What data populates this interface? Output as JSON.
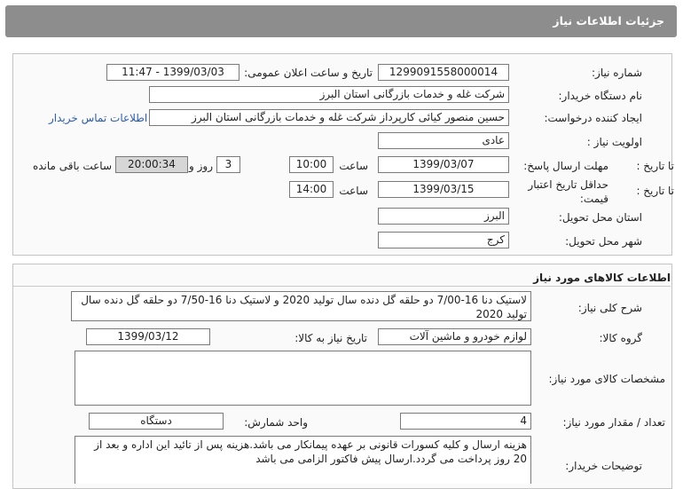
{
  "header": {
    "title": "جزئیات اطلاعات نیاز"
  },
  "info": {
    "need_number_label": "شماره نیاز:",
    "need_number": "1299091558000014",
    "announce_label": "تاریخ و ساعت اعلان عمومی:",
    "announce_value": "1399/03/03 - 11:47",
    "buyer_org_label": "نام دستگاه خریدار:",
    "buyer_org": "شرکت غله و خدمات بازرگانی استان البرز",
    "creator_label": "ایجاد کننده درخواست:",
    "creator": "حسین منصور کیائی کارپرداز شرکت غله و خدمات بازرگانی استان البرز",
    "contact_link": "اطلاعات تماس خریدار",
    "priority_label": "اولویت نیاز :",
    "priority": "عادی",
    "deadline_label": "مهلت ارسال پاسخ:",
    "until_date_label": "تا تاریخ :",
    "deadline_date": "1399/03/07",
    "time_label": "ساعت",
    "deadline_time": "10:00",
    "days_value": "3",
    "days_label": "روز و",
    "remaining_value": "20:00:34",
    "remaining_label": "ساعت باقی مانده",
    "validity_label": "حداقل تاریخ اعتبار قیمت:",
    "validity_date": "1399/03/15",
    "validity_time": "14:00",
    "province_label": "استان محل تحویل:",
    "province": "البرز",
    "city_label": "شهر محل تحویل:",
    "city": "کرج"
  },
  "goods": {
    "section_title": "اطلاعات کالاهای مورد نیاز",
    "desc_label": "شرح کلی نیاز:",
    "desc": "لاستیک دنا 16-7/00 دو حلقه گل دنده  سال تولید 2020 و لاستیک دنا 16-7/50 دو حلقه گل دنده سال تولید 2020",
    "group_label": "گروه کالا:",
    "group": "لوازم خودرو و ماشین آلات",
    "need_date_label": "تاریخ نیاز به کالا:",
    "need_date": "1399/03/12",
    "specs_label": "مشخصات کالای مورد نیاز:",
    "specs": "",
    "qty_label": "تعداد / مقدار مورد نیاز:",
    "qty": "4",
    "unit_label": "واحد شمارش:",
    "unit": "دستگاه",
    "buyer_notes_label": "توضیحات خریدار:",
    "buyer_notes": "هزینه ارسال و کلیه کسورات قانونی بر عهده پیمانکار می باشد.هزینه پس از تائید این اداره و بعد از 20 روز پرداخت می گردد.ارسال پیش فاکتور الزامی می باشد"
  }
}
